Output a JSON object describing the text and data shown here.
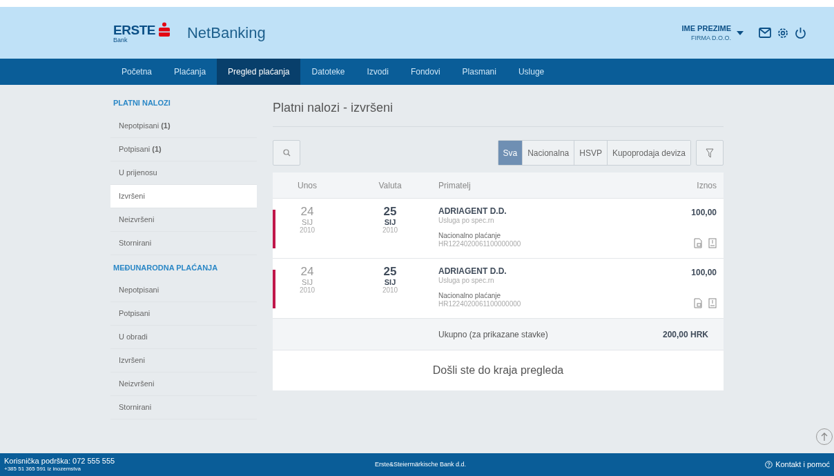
{
  "header": {
    "logo_text": "ERSTE",
    "logo_sub": "Bank",
    "app_name": "NetBanking",
    "user_name": "IME PREZIME",
    "company": "FIRMA D.O.O."
  },
  "nav": [
    {
      "label": "Početna",
      "selected": false
    },
    {
      "label": "Plaćanja",
      "selected": false
    },
    {
      "label": "Pregled plaćanja",
      "selected": true
    },
    {
      "label": "Datoteke",
      "selected": false
    },
    {
      "label": "Izvodi",
      "selected": false
    },
    {
      "label": "Fondovi",
      "selected": false
    },
    {
      "label": "Plasmani",
      "selected": false
    },
    {
      "label": "Usluge",
      "selected": false
    }
  ],
  "sidebar": [
    {
      "title": "PLATNI NALOZI",
      "items": [
        {
          "label": "Nepotpisani **(1)**",
          "selected": false
        },
        {
          "label": "Potpisani **(1)**",
          "selected": false
        },
        {
          "label": "U prijenosu",
          "selected": false
        },
        {
          "label": "Izvršeni",
          "selected": true
        },
        {
          "label": "Neizvršeni",
          "selected": false
        },
        {
          "label": "Stornirani",
          "selected": false
        }
      ]
    },
    {
      "title": "MEĐUNARODNA PLAĆANJA",
      "items": [
        {
          "label": "Nepotpisani",
          "selected": false
        },
        {
          "label": "Potpisani",
          "selected": false
        },
        {
          "label": "U obradi",
          "selected": false
        },
        {
          "label": "Izvršeni",
          "selected": false
        },
        {
          "label": "Neizvršeni",
          "selected": false
        },
        {
          "label": "Stornirani",
          "selected": false
        }
      ]
    }
  ],
  "page_title": "Platni nalozi - izvršeni",
  "filters": [
    {
      "label": "Sva",
      "selected": true
    },
    {
      "label": "Nacionalna",
      "selected": false
    },
    {
      "label": "HSVP",
      "selected": false
    },
    {
      "label": "Kupoprodaja deviza",
      "selected": false
    }
  ],
  "table": {
    "columns": [
      "Unos",
      "Valuta",
      "Primatelj",
      "Iznos"
    ],
    "rows": [
      {
        "entry_day": "24",
        "entry_month": "SIJ",
        "entry_year": "2010",
        "value_day": "25",
        "value_month": "SIJ",
        "value_year": "2010",
        "recipient": "ADRIAGENT D.D.",
        "description": "Usluga po spec.rn",
        "type": "Nacionalno plaćanje",
        "account": "HR1224020061100000000",
        "amount": "100,00",
        "color": "#c0174a"
      },
      {
        "entry_day": "24",
        "entry_month": "SIJ",
        "entry_year": "2010",
        "value_day": "25",
        "value_month": "SIJ",
        "value_year": "2010",
        "recipient": "ADRIAGENT D.D.",
        "description": "Usluga po spec.rn",
        "type": "Nacionalno plaćanje",
        "account": "HR1224020061100000000",
        "amount": "100,00",
        "color": "#c0174a"
      }
    ],
    "total_label": "Ukupno (za prikazane stavke)",
    "total": "200,00 HRK"
  },
  "end_message": "Došli ste do kraja pregleda",
  "footer": {
    "support": "Korisnička podrška: 072 555 555",
    "support_abroad": "+385 51 365 591 iz inozemstva",
    "bank": "Erste&Steiermärkische Bank d.d.",
    "contact": "Kontakt i pomoć"
  }
}
